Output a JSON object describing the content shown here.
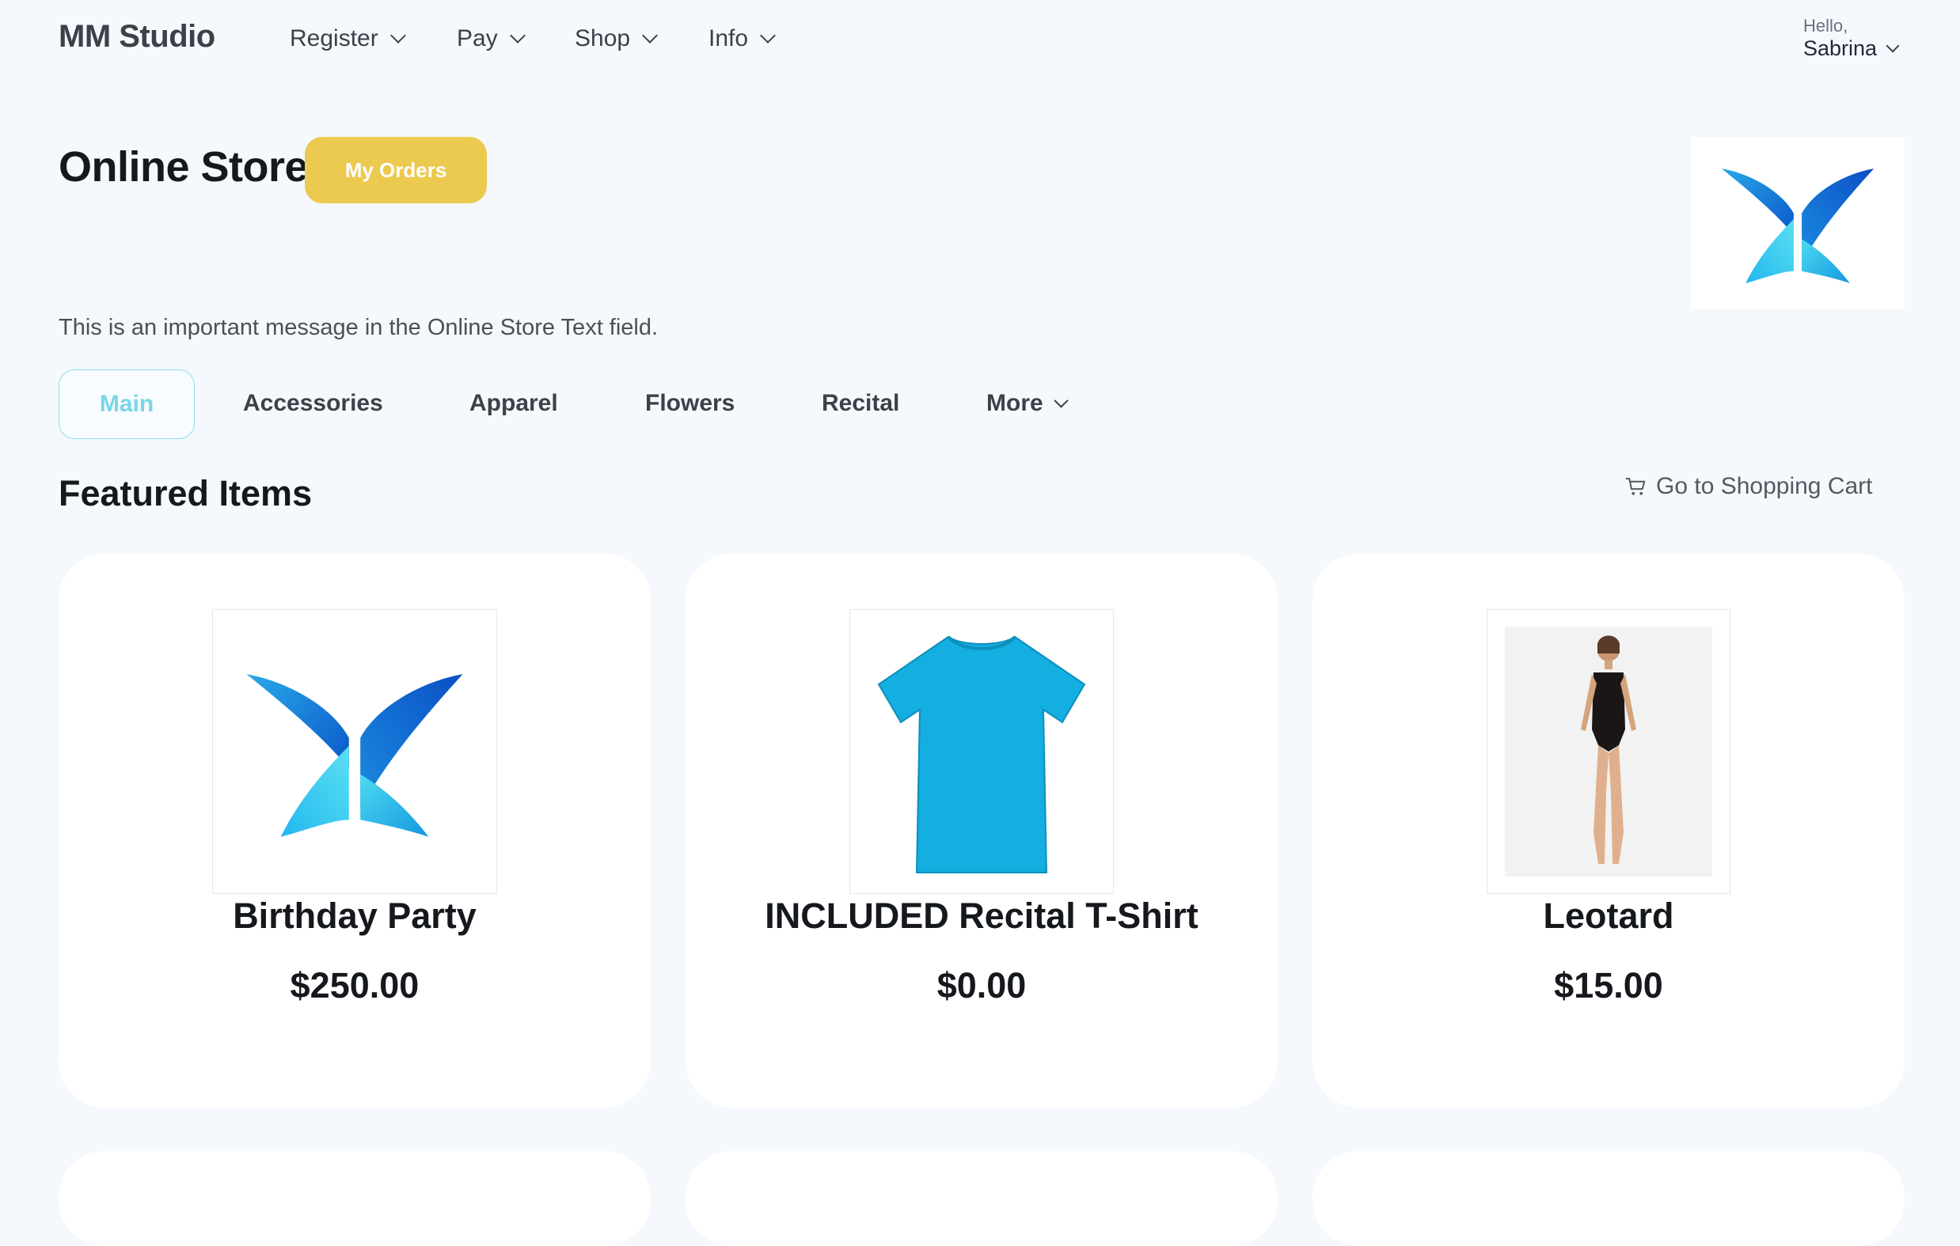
{
  "brand": "MM Studio",
  "nav": [
    {
      "label": "Register"
    },
    {
      "label": "Pay"
    },
    {
      "label": "Shop"
    },
    {
      "label": "Info"
    }
  ],
  "user": {
    "greeting": "Hello,",
    "name": "Sabrina"
  },
  "header": {
    "title": "Online Store",
    "orders_button": "My Orders"
  },
  "message": "This is an important message in the Online Store Text field.",
  "tabs": [
    {
      "label": "Main",
      "active": true
    },
    {
      "label": "Accessories"
    },
    {
      "label": "Apparel"
    },
    {
      "label": "Flowers"
    },
    {
      "label": "Recital"
    },
    {
      "label": "More"
    }
  ],
  "featured": {
    "title": "Featured Items",
    "cart_link": "Go to Shopping Cart",
    "items": [
      {
        "name": "Birthday Party",
        "price": "$250.00"
      },
      {
        "name": "INCLUDED Recital T-Shirt",
        "price": "$0.00"
      },
      {
        "name": "Leotard",
        "price": "$15.00"
      }
    ]
  },
  "colors": {
    "accent": "#ecc94f",
    "active_tab": "#79d6e6",
    "background": "#f5f8fc"
  }
}
